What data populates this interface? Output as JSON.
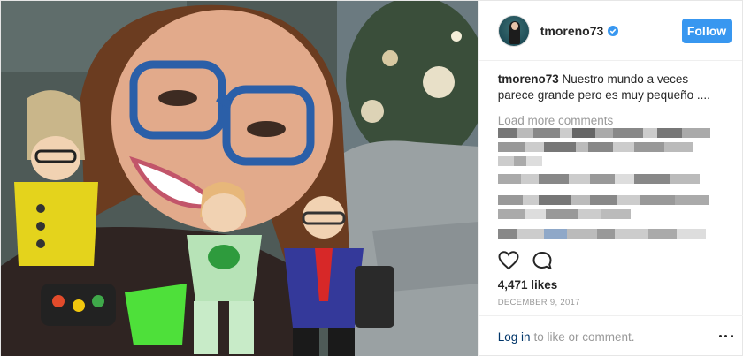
{
  "post": {
    "username": "tmoreno73",
    "verified": true,
    "follow_label": "Follow",
    "caption_username": "tmoreno73",
    "caption_text": "Nuestro mundo a veces parece grande pero es muy pequeño ....",
    "load_more_label": "Load more comments",
    "likes_text": "4,471 likes",
    "date_text": "DECEMBER 9, 2017",
    "login_link": "Log in",
    "login_suffix": "to like or comment."
  },
  "icons": [
    "verified-badge-icon",
    "heart-icon",
    "comment-icon",
    "more-options-icon"
  ],
  "colors": {
    "accent": "#3897f0",
    "link": "#003569",
    "muted": "#999999",
    "text": "#262626"
  }
}
